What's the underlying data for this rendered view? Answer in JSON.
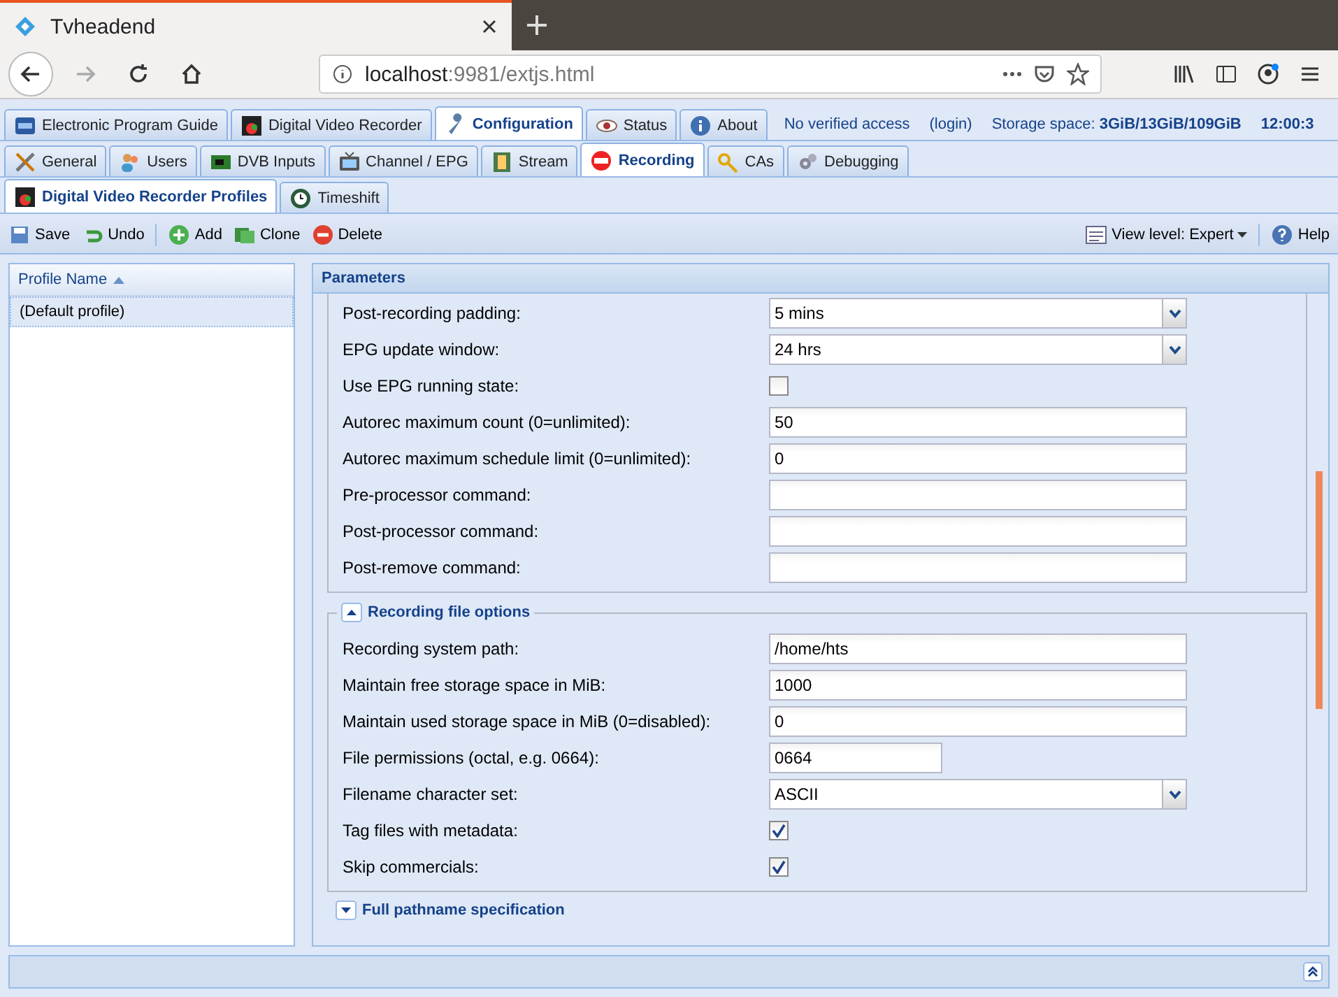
{
  "browser": {
    "tab_title": "Tvheadend",
    "url_host": "localhost",
    "url_path": ":9981/extjs.html"
  },
  "main_tabs": [
    {
      "label": "Electronic Program Guide",
      "selected": false
    },
    {
      "label": "Digital Video Recorder",
      "selected": false
    },
    {
      "label": "Configuration",
      "selected": true
    },
    {
      "label": "Status",
      "selected": false
    },
    {
      "label": "About",
      "selected": false
    }
  ],
  "header_info": {
    "access": "No verified access",
    "login": "(login)",
    "storage_label": "Storage space:",
    "storage_value": "3GiB/13GiB/109GiB",
    "time": "12:00:3"
  },
  "config_tabs": [
    {
      "label": "General",
      "selected": false
    },
    {
      "label": "Users",
      "selected": false
    },
    {
      "label": "DVB Inputs",
      "selected": false
    },
    {
      "label": "Channel / EPG",
      "selected": false
    },
    {
      "label": "Stream",
      "selected": false
    },
    {
      "label": "Recording",
      "selected": true
    },
    {
      "label": "CAs",
      "selected": false
    },
    {
      "label": "Debugging",
      "selected": false
    }
  ],
  "sub_tabs": [
    {
      "label": "Digital Video Recorder Profiles",
      "selected": true
    },
    {
      "label": "Timeshift",
      "selected": false
    }
  ],
  "toolbar": {
    "buttons": [
      {
        "label": "Save"
      },
      {
        "label": "Undo"
      },
      {
        "label": "Add"
      },
      {
        "label": "Clone"
      },
      {
        "label": "Delete"
      }
    ],
    "view_level": "View level: Expert",
    "help": "Help"
  },
  "grid": {
    "column": "Profile Name",
    "rows": [
      {
        "name": "(Default profile)",
        "selected": true
      }
    ]
  },
  "parameters": {
    "title": "Parameters",
    "fields": [
      {
        "label": "Post-recording padding:",
        "kind": "select",
        "value": "5 mins"
      },
      {
        "label": "EPG update window:",
        "kind": "select",
        "value": "24 hrs"
      },
      {
        "label": "Use EPG running state:",
        "kind": "checkbox",
        "checked": false
      },
      {
        "label": "Autorec maximum count (0=unlimited):",
        "kind": "text",
        "value": "50"
      },
      {
        "label": "Autorec maximum schedule limit (0=unlimited):",
        "kind": "text",
        "value": "0"
      },
      {
        "label": "Pre-processor command:",
        "kind": "text"
      },
      {
        "label": "Post-processor command:",
        "kind": "text"
      },
      {
        "label": "Post-remove command:",
        "kind": "text"
      }
    ],
    "sections": [
      {
        "title": "Recording file options",
        "expanded": true,
        "fields": [
          {
            "label": "Recording system path:",
            "kind": "text",
            "value": "/home/hts"
          },
          {
            "label": "Maintain free storage space in MiB:",
            "kind": "text",
            "value": "1000"
          },
          {
            "label": "Maintain used storage space in MiB (0=disabled):",
            "kind": "text",
            "value": "0"
          },
          {
            "label": "File permissions (octal, e.g. 0664):",
            "kind": "short-text",
            "value": "0664"
          },
          {
            "label": "Filename character set:",
            "kind": "select",
            "value": "ASCII"
          },
          {
            "label": "Tag files with metadata:",
            "kind": "checkbox",
            "checked": true
          },
          {
            "label": "Skip commercials:",
            "kind": "checkbox",
            "checked": true
          }
        ]
      },
      {
        "title": "Full pathname specification",
        "expanded": false
      }
    ]
  }
}
